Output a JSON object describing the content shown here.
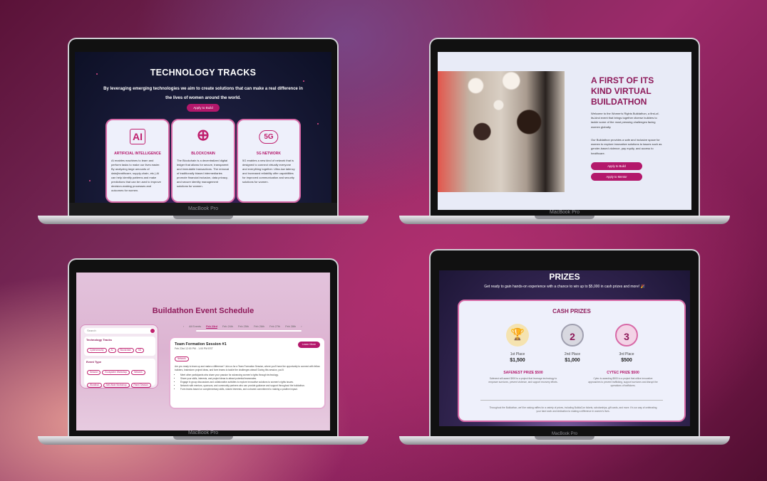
{
  "device_label": "MacBook Pro",
  "tech_tracks": {
    "title": "TECHNOLOGY TRACKS",
    "subtitle": "By leveraging emerging technologies we aim to create solutions that can make a real difference in the lives of women around the world.",
    "cta": "Apply to Build",
    "cards": [
      {
        "icon": "ai-chip-icon",
        "glyph": "AI",
        "title": "ARTIFICIAL INTELLIGENCE",
        "body": "AI enables machines to learn and perform tasks to make our lives easier. By analyzing large amounts of data(healthcare, supply-chain, etc.) AI can help identify patterns and make predictions that can be used to improve decision-making processes and outcomes for women."
      },
      {
        "icon": "globe-network-icon",
        "glyph": "⊕",
        "title": "BLOCKCHAIN",
        "body": "The Blockchain is a decentralized digital ledger that allows for secure, transparent and immutable transactions. The removal of traditionally biased intermediaries promote financial inclusion, data privacy, and secure identity management solutions for women."
      },
      {
        "icon": "5g-cloud-icon",
        "glyph": "5G",
        "title": "5G NETWORK",
        "body": "5G enables a new kind of network that is designed to connect virtually everyone and everything together. Ultra-low latency and increased reliability offer capabilities for improved communication and security solutions for women."
      }
    ]
  },
  "buildathon": {
    "title": "A FIRST OF ITS KIND VIRTUAL BUILDATHON",
    "para1": "Welcome to the Women's Rights Buildathon, a first-of-its-kind event that brings together diverse builders to tackle some of the most pressing challenges facing women globally.",
    "para2": "Our Buildathon provides a safe and inclusive space for women to explore innovative solutions to issues such as gender-based violence, pay equity, and access to healthcare.",
    "btn_build": "Apply to Build",
    "btn_mentor": "Apply to Mentor"
  },
  "schedule": {
    "title": "Buildathon Event Schedule",
    "search_placeholder": "Search",
    "filter_tracks_label": "Technology Tracks",
    "tracks": [
      "Cybersecurity",
      "AI",
      "Blockchain",
      "5G",
      "Product"
    ],
    "filter_type_label": "Event Type",
    "types": [
      "Session",
      "Ecosystem Workshop",
      "Network",
      "Wordinal",
      "Self-Wide Workshop",
      "Panel Session"
    ],
    "tabs": [
      "All Events",
      "Feb 23rd",
      "Feb 24th",
      "Feb 25th",
      "Feb 26th",
      "Feb 27th",
      "Feb 28th"
    ],
    "session": {
      "title": "Team Formation Session #1",
      "time": "Feb 23rd 12:00 PM - 1:00 PM EST",
      "tag": "Network",
      "cta": "Learn More",
      "intro": "Are you ready to team up and make a difference? Join us for a Team Formation Session, where you'll have the opportunity to connect with fellow builders, brainstorm project ideas, and form teams to tackle the challenges ahead! During this session, you'll:",
      "bullets": [
        "Meet other participants who share your passion for advancing women's rights through technology.",
        "Share your skills, interests, and project ideas to attract potential teammates.",
        "Engage in group discussions and collaborative activities to explore innovative solutions to women's rights issues.",
        "Network with mentors, sponsors, and community partners who can provide guidance and support throughout the buildathon.",
        "Form teams based on complementary skills, shared interests, and a shared commitment to making a positive impact."
      ]
    }
  },
  "prizes": {
    "title": "PRIZES",
    "subtitle": "Get ready to gain hands-on experience with a chance to win up to $5,000 in cash prizes and more! 🎉",
    "cash_title": "CASH PRIZES",
    "places": [
      {
        "label": "1st Place",
        "amount": "$1,500",
        "icon": "trophy-icon",
        "glyph": "🏆"
      },
      {
        "label": "2nd Place",
        "amount": "$1,000",
        "icon": "medal-2-icon",
        "glyph": "2"
      },
      {
        "label": "3rd Place",
        "amount": "$500",
        "icon": "medal-3-icon",
        "glyph": "3"
      }
    ],
    "special": [
      {
        "title": "SAFENEST PRIZE $500",
        "body": "Safenest will award $500 to a project that leverage technology to empower survivors, prevent violence, and support recovery efforts."
      },
      {
        "title": "CYTEC PRIZE $500",
        "body": "Cytec is awarding $500 to a project that utilize innovative approaches to prevent trafficking, support survivors and disrupt the operations of traffickers."
      }
    ],
    "footer": "Throughout the Buildathon, we'll be raising raffles for a variety of prizes, including BuildaCon tickets, scholarships, gift cards, and more. It's our way of celebrating your hard work and dedication to making a difference in women's lives."
  }
}
